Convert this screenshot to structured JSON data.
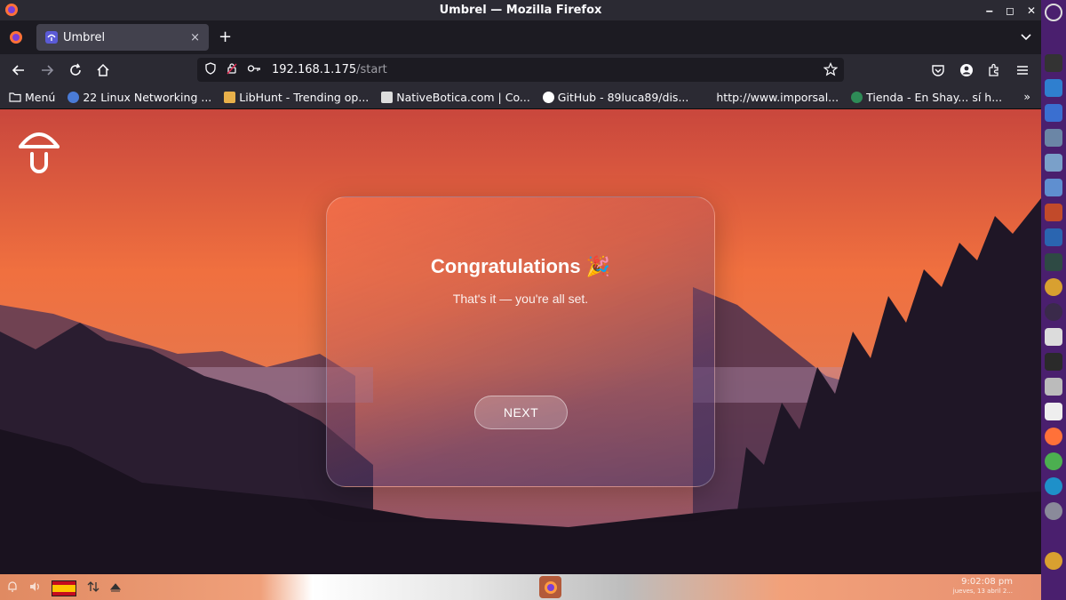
{
  "window": {
    "title": "Umbrel — Mozilla Firefox"
  },
  "tab": {
    "title": "Umbrel",
    "close_symbol": "×"
  },
  "newtab_symbol": "+",
  "url": {
    "host": "192.168.1.175",
    "path": "/start"
  },
  "bookmarks": [
    {
      "label": "Menú",
      "icon": "folder-icon",
      "color": "#fbfbfe"
    },
    {
      "label": "22 Linux Networking ...",
      "icon": "site-icon",
      "color": "#4a7bd6"
    },
    {
      "label": "LibHunt - Trending op...",
      "icon": "libhunt-icon",
      "color": "#e8b04a"
    },
    {
      "label": "NativeBotica.com | Co...",
      "icon": "nativebotica-icon",
      "color": "#dddddd"
    },
    {
      "label": "GitHub - 89luca89/dis...",
      "icon": "github-icon",
      "color": "#ffffff"
    },
    {
      "label": "http://www.imporsal...",
      "icon": "blank-icon",
      "color": "#2b2a33"
    },
    {
      "label": "Tienda - En Shay... sí h...",
      "icon": "tienda-icon",
      "color": "#2e8b57"
    }
  ],
  "bookmarks_more_symbol": "»",
  "card": {
    "title": "Congratulations",
    "title_emoji": "🎉",
    "subtitle": "That's it — you're all set.",
    "next_label": "NEXT"
  },
  "panel": {
    "clock_time": "9:02:08 pm",
    "clock_date": "jueves, 13 abril 2..."
  },
  "colors": {
    "dock": "#4a1f6e",
    "chrome": "#2b2a33",
    "chrome_dark": "#1c1b22"
  }
}
